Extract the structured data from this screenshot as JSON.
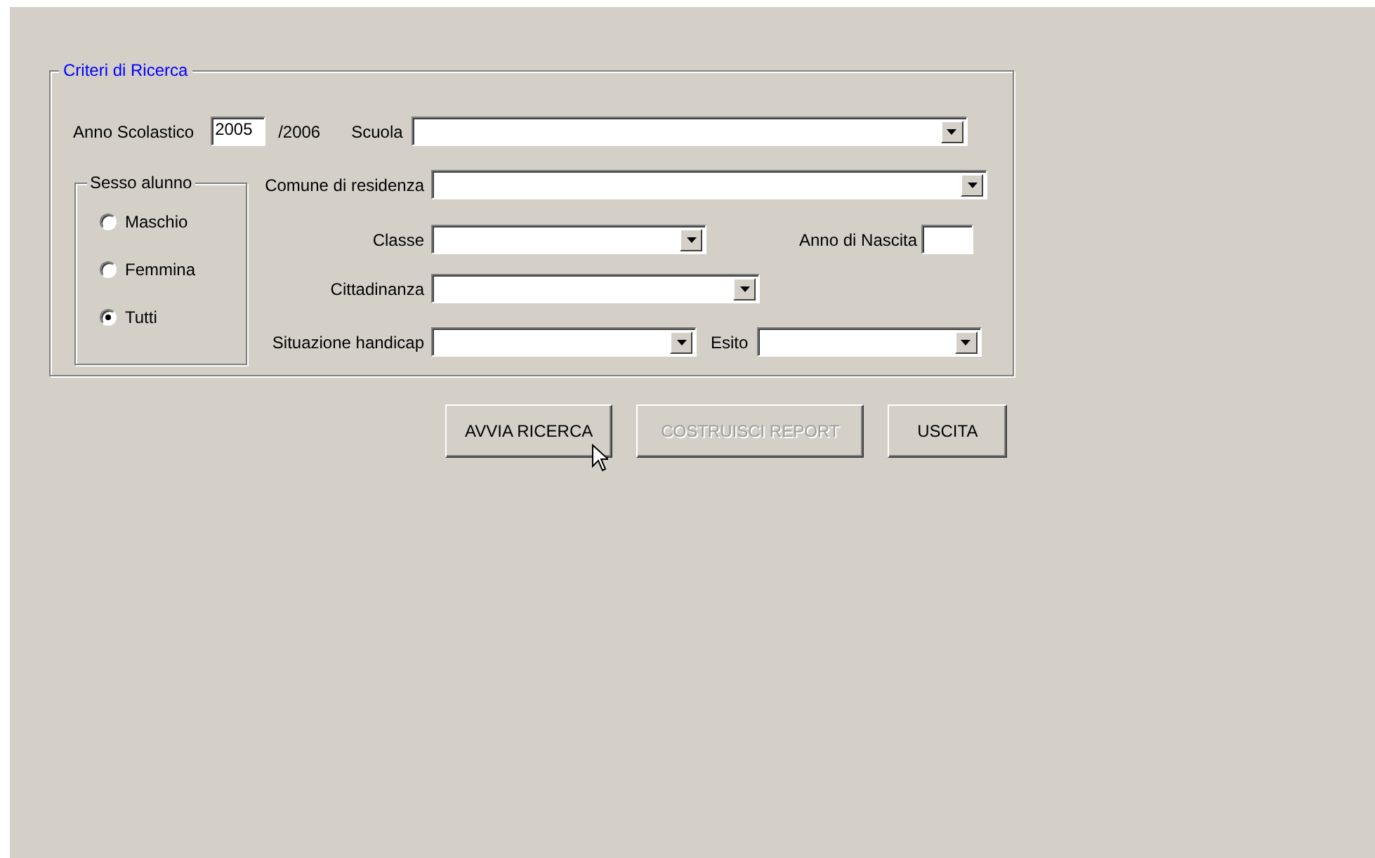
{
  "group": {
    "title": "Criteri di Ricerca"
  },
  "anno_scolastico": {
    "label": "Anno Scolastico",
    "value": "2005",
    "suffix": "/2006"
  },
  "scuola": {
    "label": "Scuola"
  },
  "sesso": {
    "title": "Sesso alunno",
    "options": [
      {
        "label": "Maschio",
        "selected": false
      },
      {
        "label": "Femmina",
        "selected": false
      },
      {
        "label": "Tutti",
        "selected": true
      }
    ]
  },
  "comune": {
    "label": "Comune di residenza"
  },
  "classe": {
    "label": "Classe"
  },
  "anno_nascita": {
    "label": "Anno di Nascita"
  },
  "cittadinanza": {
    "label": "Cittadinanza"
  },
  "situazione_handicap": {
    "label": "Situazione handicap"
  },
  "esito": {
    "label": "Esito"
  },
  "buttons": [
    {
      "label": "AVVIA RICERCA",
      "disabled": false
    },
    {
      "label": "COSTRUISCI REPORT",
      "disabled": true
    },
    {
      "label": "USCITA",
      "disabled": false
    }
  ]
}
